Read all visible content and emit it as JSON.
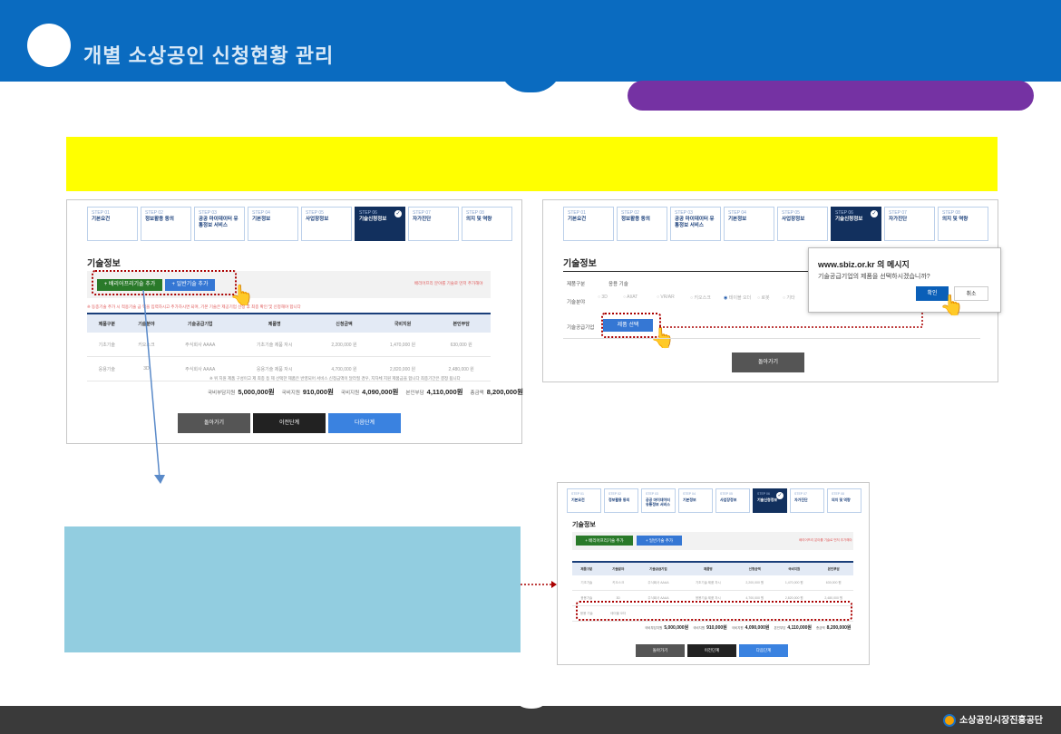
{
  "header": {
    "title": "개별 소상공인 신청현황 관리"
  },
  "steps": [
    {
      "num": "STEP 01",
      "label": "기본요건"
    },
    {
      "num": "STEP 02",
      "label": "정보활용 동의"
    },
    {
      "num": "STEP 03",
      "label": "공공 마이데이터 유통정보 서비스"
    },
    {
      "num": "STEP 04",
      "label": "기본정보"
    },
    {
      "num": "STEP 05",
      "label": "사업장정보"
    },
    {
      "num": "STEP 06",
      "label": "기술신청정보"
    },
    {
      "num": "STEP 07",
      "label": "자가진단"
    },
    {
      "num": "STEP 08",
      "label": "의지 및 역량"
    }
  ],
  "panel1": {
    "section_title": "기술정보",
    "btn_smart": "+ 배리어프리기술 추가",
    "btn_general": "+ 일반기술 추가",
    "right_note": "배리어프리 분야를 기술로 먼저 추가해야",
    "red_note": "※ 동종기술 추가 시 적용기술 금 액을 입력하시고 추가하시면 되며, 기본 기술은 제공기업 선정 후 최종 확인 및 신청해야 합니다",
    "columns": [
      "제품구분",
      "기술분야",
      "기술공급기업",
      "제품명",
      "신청금액",
      "국비지원",
      "본인부담"
    ],
    "rows": [
      [
        "기초기술",
        "키오스크",
        "주식회사 AAAA",
        "기초기술 제품 자시",
        "2,200,000 원",
        "1,470,000 원",
        "630,000 원"
      ],
      [
        "응용기술",
        "3D",
        "주식회사 AAAA",
        "응용기술 제품 자시",
        "4,700,000 원",
        "2,820,000 원",
        "2,480,000 원"
      ]
    ],
    "sum_note": "※ 위 지원 제품 구성이고 제 최종 등 제 선택한 제품은 반영되어 서비스 신청금액이 달라질 경우, 지자체 지원 제품금을 합니다 최종기간은 결정 됩니다",
    "sum": [
      {
        "label": "국비부담지원",
        "value": "5,000,000원"
      },
      {
        "label": "국비지원",
        "value": "910,000원"
      },
      {
        "label": "국비지원",
        "value": "4,090,000원"
      },
      {
        "label": "본인부담",
        "value": "4,110,000원"
      },
      {
        "label": "총금액",
        "value": "8,200,000원"
      }
    ],
    "btn_back": "돌아가기",
    "btn_prev": "이전단계",
    "btn_next": "다음단계"
  },
  "panel2": {
    "section_title": "기술정보",
    "label_type": "제품구분",
    "value_type": "응용 기술",
    "label_field": "기술분야",
    "radios": [
      "3D",
      "AI/AT",
      "VR/AR",
      "키오스크",
      "테이블 오더",
      "로봇",
      "기타"
    ],
    "label_company": "기술공급기업",
    "btn_select": "제품 선택",
    "btn_back": "돌아가기",
    "dialog_title": "www.sbiz.or.kr 의 메시지",
    "dialog_msg": "기술공급기업의 제품을 선택하시겠습니까?",
    "dialog_ok": "확인",
    "dialog_cancel": "취소"
  },
  "panel3": {
    "section_title": "기술정보",
    "btn_smart": "+ 배리어프리기술 추가",
    "btn_general": "+ 일반기술 추가",
    "right_note": "배리어프리 분야를 기술로 먼저 추가해야",
    "columns": [
      "제품구분",
      "기술분야",
      "기술공급기업",
      "제품명",
      "신청금액",
      "국비지원",
      "본인부담"
    ],
    "rows": [
      [
        "기초기술",
        "키오스크",
        "주식회사 AAAA",
        "기초기술 제품 자시",
        "2,200,000 원",
        "1,470,000 원",
        "630,000 원"
      ],
      [
        "응용기술",
        "3D",
        "주식회사 AAAA",
        "응용기술 제품 자시",
        "4,700,000 원",
        "2,820,000 원",
        "2,480,000 원"
      ],
      [
        "응용 기술",
        "테이블 오더",
        "",
        "",
        "",
        "",
        ""
      ]
    ],
    "sum": [
      {
        "label": "국비부담지원",
        "value": "5,000,000원"
      },
      {
        "label": "국비지원",
        "value": "910,000원"
      },
      {
        "label": "국비지원",
        "value": "4,090,000원"
      },
      {
        "label": "본인부담",
        "value": "4,110,000원"
      },
      {
        "label": "총금액",
        "value": "8,200,000원"
      }
    ],
    "btn_back": "돌아가기",
    "btn_prev": "이전단계",
    "btn_next": "다음단계"
  },
  "footer": {
    "org": "소상공인시장진흥공단"
  },
  "colors": {
    "header_blue": "#0a6bc0",
    "purple": "#7532a3",
    "yellow": "#ffff00",
    "navy": "#12305e",
    "light_blue_box": "#92cde0"
  }
}
